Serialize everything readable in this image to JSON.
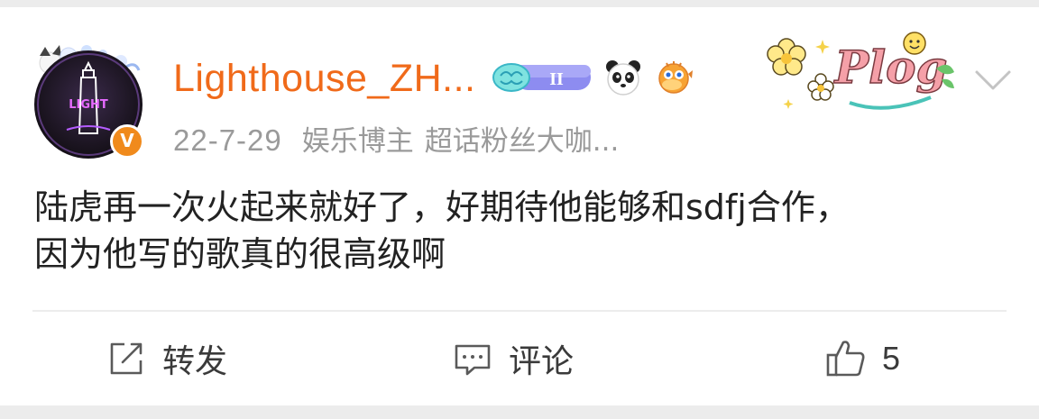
{
  "post": {
    "author": {
      "name": "Lighthouse_ZH...",
      "verified_badge": "V",
      "avatar_text": "LIGHT"
    },
    "badges": {
      "level_badge_text": "II",
      "icons": [
        "brain-icon",
        "panda-icon",
        "pufferfish-icon"
      ]
    },
    "sticker_text": "Plog",
    "meta": {
      "date": "22-7-29",
      "role": "娱乐博主",
      "title": "超话粉丝大咖..."
    },
    "content_lines": [
      "陆虎再一次火起来就好了，好期待他能够和sdfj合作，",
      "因为他写的歌真的很高级啊"
    ],
    "actions": {
      "repost_label": "转发",
      "comment_label": "评论",
      "like_count": "5"
    },
    "colors": {
      "username": "#f06a1a",
      "verified": "#f08a1c",
      "meta": "#9a9a9a",
      "text": "#222222",
      "background": "#ececec"
    }
  }
}
